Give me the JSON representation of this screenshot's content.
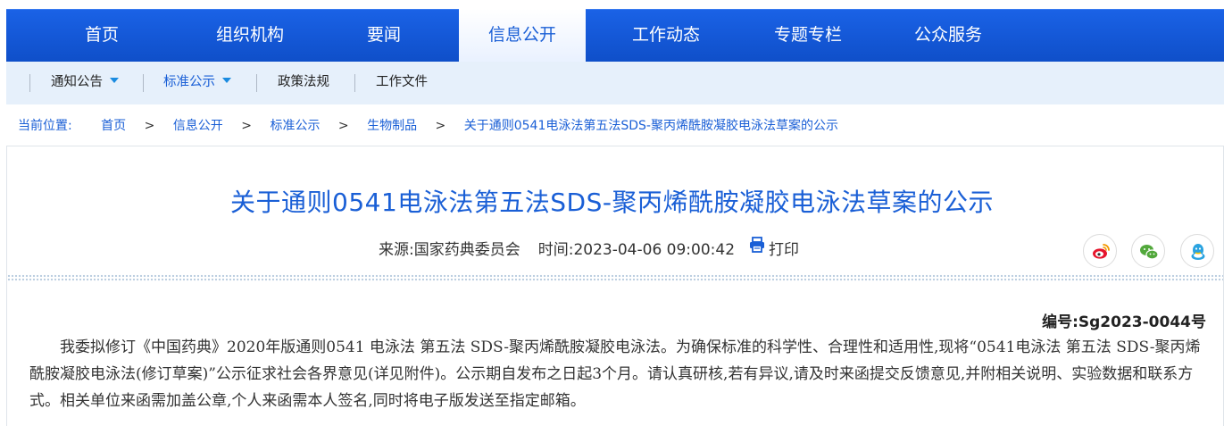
{
  "nav": {
    "items": [
      "首页",
      "组织机构",
      "要闻",
      "信息公开",
      "工作动态",
      "专题专栏",
      "公众服务"
    ],
    "active": "信息公开"
  },
  "subnav": {
    "items": [
      "通知公告",
      "标准公示",
      "政策法规",
      "工作文件"
    ]
  },
  "breadcrumb": {
    "label": "当前位置:",
    "items": [
      "首页",
      "信息公开",
      "标准公示",
      "生物制品",
      "关于通则0541电泳法第五法SDS-聚丙烯酰胺凝胶电泳法草案的公示"
    ],
    "separator": ">"
  },
  "article": {
    "title": "关于通则0541电泳法第五法SDS-聚丙烯酰胺凝胶电泳法草案的公示",
    "source": "来源:国家药典委员会",
    "time": "时间:2023-04-06 09:00:42",
    "print_label": "打印",
    "doc_number": "编号:Sg2023-0044号",
    "body": "我委拟修订《中国药典》2020年版通则0541 电泳法 第五法 SDS-聚丙烯酰胺凝胶电泳法。为确保标准的科学性、合理性和适用性,现将“0541电泳法 第五法 SDS-聚丙烯酰胺凝胶电泳法(修订草案)”公示征求社会各界意见(详见附件)。公示期自发布之日起3个月。请认真研核,若有异议,请及时来函提交反馈意见,并附相关说明、实验数据和联系方式。相关单位来函需加盖公章,个人来函需本人签名,同时将电子版发送至指定邮箱。"
  },
  "share_icons": [
    "weibo-icon",
    "wechat-icon",
    "qq-icon"
  ],
  "colors": {
    "nav_bg": "#1357d8",
    "accent": "#1a5fd6",
    "subnav_bg": "#e6f0fb",
    "weibo": "#e6162d",
    "wechat": "#52a83c",
    "qq": "#2aa3e0"
  }
}
